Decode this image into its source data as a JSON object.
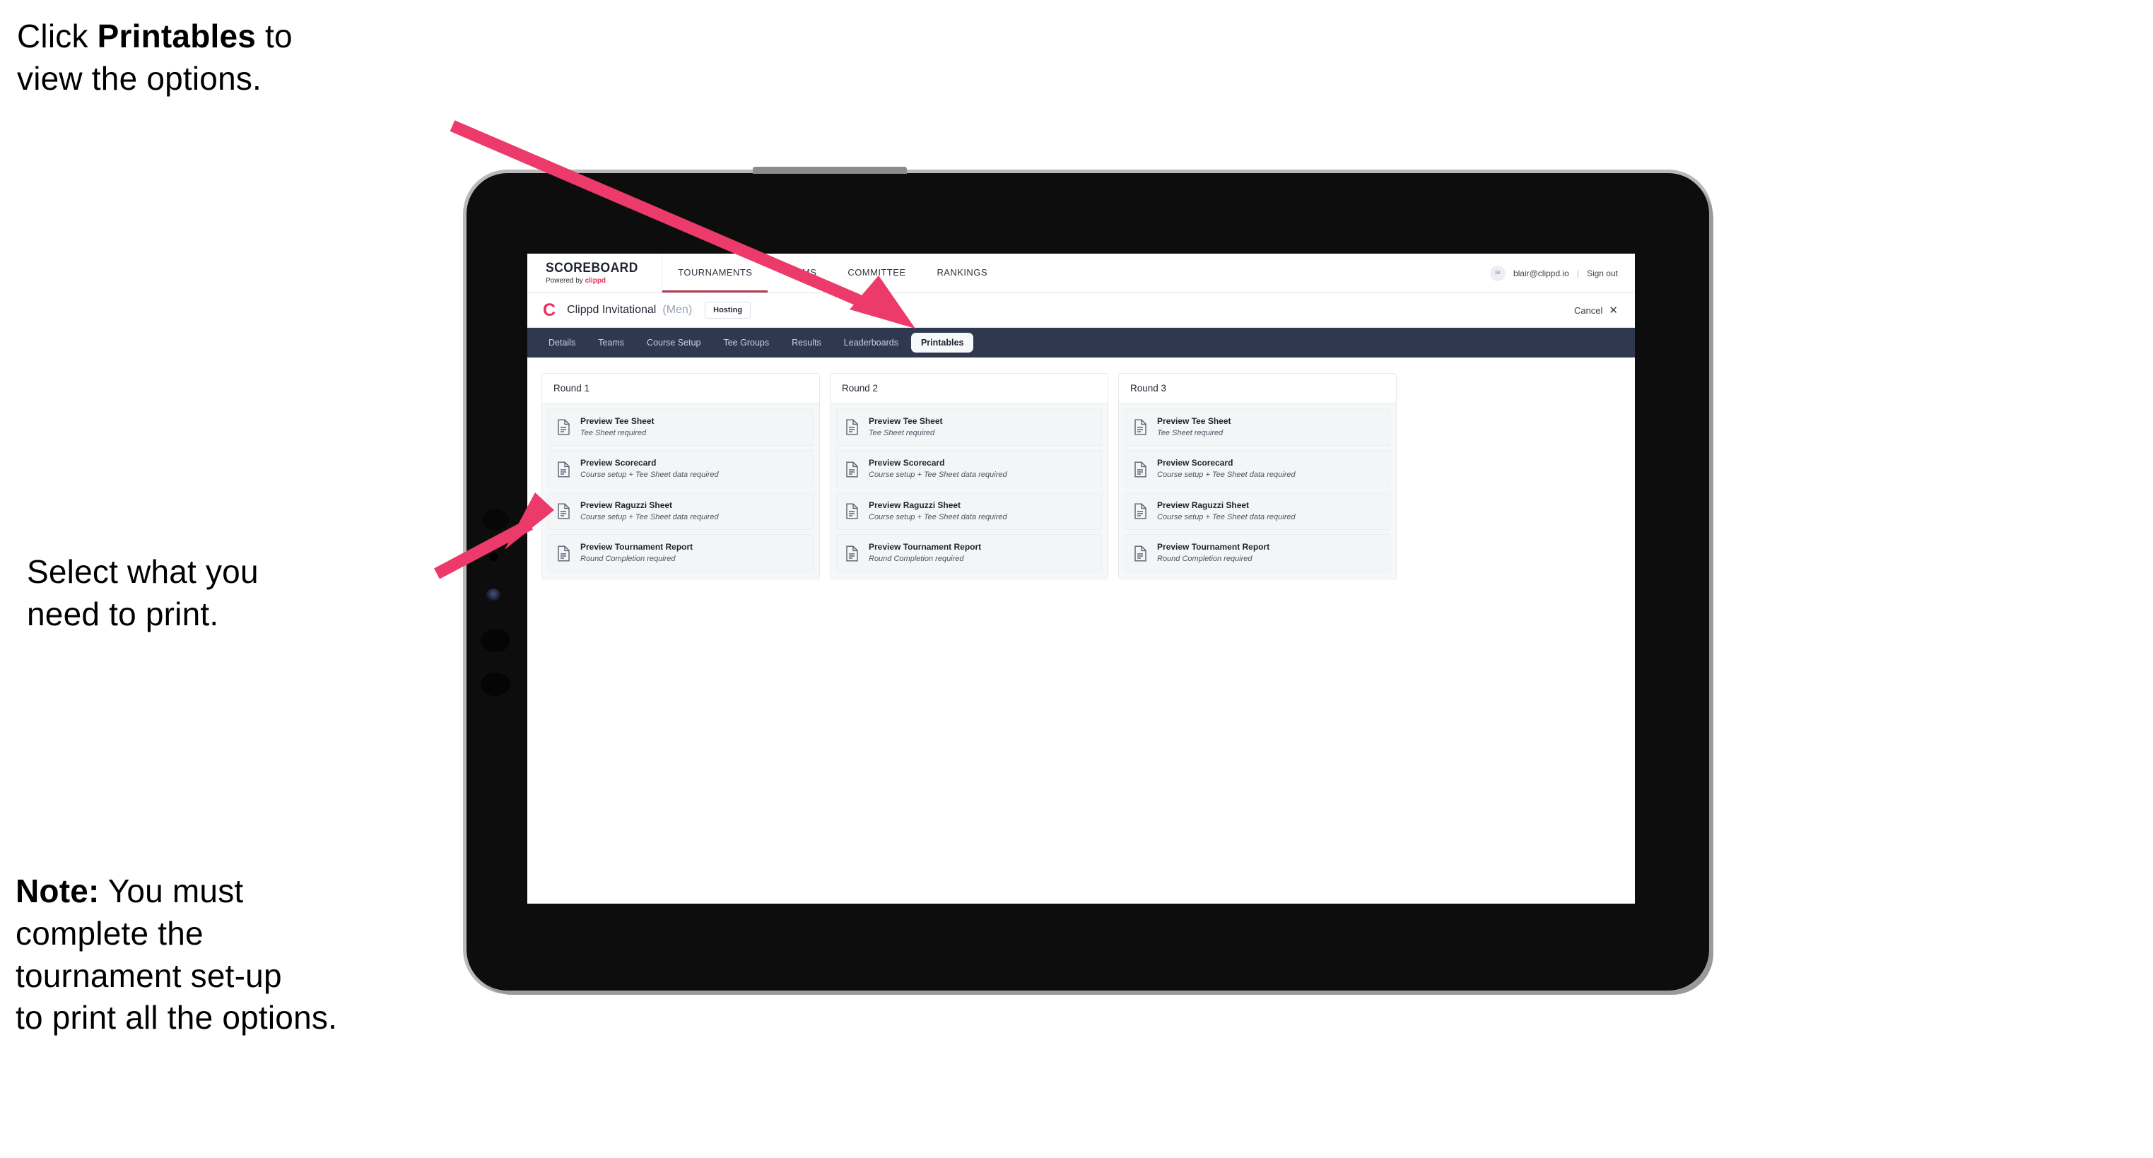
{
  "annotations": [
    {
      "id": "annot-1",
      "text": "Click ",
      "bold": "Printables",
      "text2": " to\nview the options."
    },
    {
      "id": "annot-2",
      "text": "Select what you\n need to print."
    },
    {
      "id": "annot-3",
      "bold": "Note:",
      "text2": " You must\ncomplete the\ntournament set-up\nto print all the options."
    }
  ],
  "annotation_text": {
    "line1_pre": "Click ",
    "line1_bold": "Printables",
    "line1_post": " to\nview the options.",
    "line2": "Select what you\n need to print.",
    "line3_bold": "Note:",
    "line3_post": " You must\ncomplete the\ntournament set-up\nto print all the options."
  },
  "arrow_color": "#ec3a6a",
  "app": {
    "topnav": {
      "brand_title": "SCOREBOARD",
      "brand_sub_prefix": "Powered by ",
      "brand_sub_accent": "clippd",
      "items": [
        {
          "label": "TOURNAMENTS",
          "active": true
        },
        {
          "label": "TEAMS",
          "active": false
        },
        {
          "label": "COMMITTEE",
          "active": false
        },
        {
          "label": "RANKINGS",
          "active": false
        }
      ],
      "avatar_initials": "✉",
      "user_email": "blair@clippd.io",
      "divider": "|",
      "sign_out": "Sign out"
    },
    "tournament_row": {
      "logo_letter": "C",
      "name": "Clippd Invitational",
      "gender": "(Men)",
      "status_badge": "Hosting",
      "cancel_label": "Cancel",
      "cancel_icon": "✕"
    },
    "tabs": [
      {
        "label": "Details",
        "active": false
      },
      {
        "label": "Teams",
        "active": false
      },
      {
        "label": "Course Setup",
        "active": false
      },
      {
        "label": "Tee Groups",
        "active": false
      },
      {
        "label": "Results",
        "active": false
      },
      {
        "label": "Leaderboards",
        "active": false
      },
      {
        "label": "Printables",
        "active": true
      }
    ],
    "rounds": [
      {
        "title": "Round 1",
        "items": [
          {
            "title": "Preview Tee Sheet",
            "sub": "Tee Sheet required"
          },
          {
            "title": "Preview Scorecard",
            "sub": "Course setup + Tee Sheet data required"
          },
          {
            "title": "Preview Raguzzi Sheet",
            "sub": "Course setup + Tee Sheet data required"
          },
          {
            "title": "Preview Tournament Report",
            "sub": "Round Completion required"
          }
        ]
      },
      {
        "title": "Round 2",
        "items": [
          {
            "title": "Preview Tee Sheet",
            "sub": "Tee Sheet required"
          },
          {
            "title": "Preview Scorecard",
            "sub": "Course setup + Tee Sheet data required"
          },
          {
            "title": "Preview Raguzzi Sheet",
            "sub": "Course setup + Tee Sheet data required"
          },
          {
            "title": "Preview Tournament Report",
            "sub": "Round Completion required"
          }
        ]
      },
      {
        "title": "Round 3",
        "items": [
          {
            "title": "Preview Tee Sheet",
            "sub": "Tee Sheet required"
          },
          {
            "title": "Preview Scorecard",
            "sub": "Course setup + Tee Sheet data required"
          },
          {
            "title": "Preview Raguzzi Sheet",
            "sub": "Course setup + Tee Sheet data required"
          },
          {
            "title": "Preview Tournament Report",
            "sub": "Round Completion required"
          }
        ]
      }
    ]
  },
  "colors": {
    "accent_pink": "#e8315f",
    "tabbar_bg": "#2e3950",
    "arrow": "#ec3a6a",
    "tab_active_bg": "#f7f8fa"
  }
}
